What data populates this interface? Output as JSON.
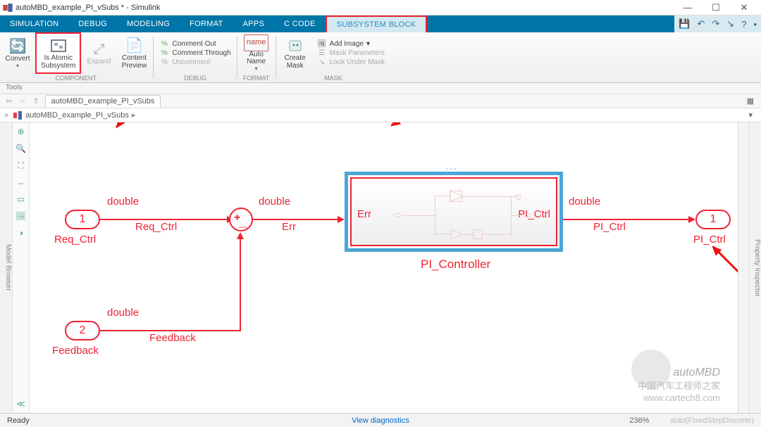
{
  "window": {
    "title": "autoMBD_example_PI_vSubs * - Simulink"
  },
  "ribbon": {
    "tabs": [
      "SIMULATION",
      "DEBUG",
      "MODELING",
      "FORMAT",
      "APPS",
      "C CODE",
      "SUBSYSTEM BLOCK"
    ],
    "context_tab_index": 6
  },
  "toolstrip": {
    "convert": "Convert",
    "atomic_top": "Is Atomic",
    "atomic_bot": "Subsystem",
    "expand": "Expand",
    "content_top": "Content",
    "content_bot": "Preview",
    "group_component": "COMPONENT",
    "comment_out": "Comment Out",
    "comment_through": "Comment Through",
    "uncomment": "Uncomment",
    "group_debug": "DEBUG",
    "auto_top": "Auto",
    "auto_bot": "Name",
    "group_format": "FORMAT",
    "create_top": "Create",
    "create_bot": "Mask",
    "add_image": "Add Image",
    "mask_params": "Mask Parameters",
    "look_under": "Look Under Mask",
    "group_mask": "MASK"
  },
  "tools_label": "Tools",
  "nav": {
    "tab_name": "autoMBD_example_PI_vSubs"
  },
  "breadcrumb": {
    "root": "autoMBD_example_PI_vSubs",
    "sep": "▸"
  },
  "diagram": {
    "in1": {
      "num": "1",
      "name": "Req_Ctrl",
      "dtype": "double",
      "signal": "Req_Ctrl"
    },
    "in2": {
      "num": "2",
      "name": "Feedback",
      "dtype": "double",
      "signal": "Feedback"
    },
    "sum": {
      "label": "+_",
      "out_dtype": "double",
      "out_signal": "Err"
    },
    "sub": {
      "name": "PI_Controller",
      "in_label": "Err",
      "out_label": "PI_Ctrl",
      "out_dtype": "double",
      "out_signal": "PI_Ctrl"
    },
    "out1": {
      "num": "1",
      "name": "PI_Ctrl"
    }
  },
  "left_rail": "Model Browser",
  "right_rail": "Property Inspector",
  "status": {
    "ready": "Ready",
    "diag": "View diagnostics",
    "zoom": "236%",
    "solver": "auto(FixedStepDiscrete)"
  },
  "watermark": {
    "line1": "中国汽车工程师之家",
    "line2": "www.cartech8.com",
    "brand": "autoMBD"
  }
}
